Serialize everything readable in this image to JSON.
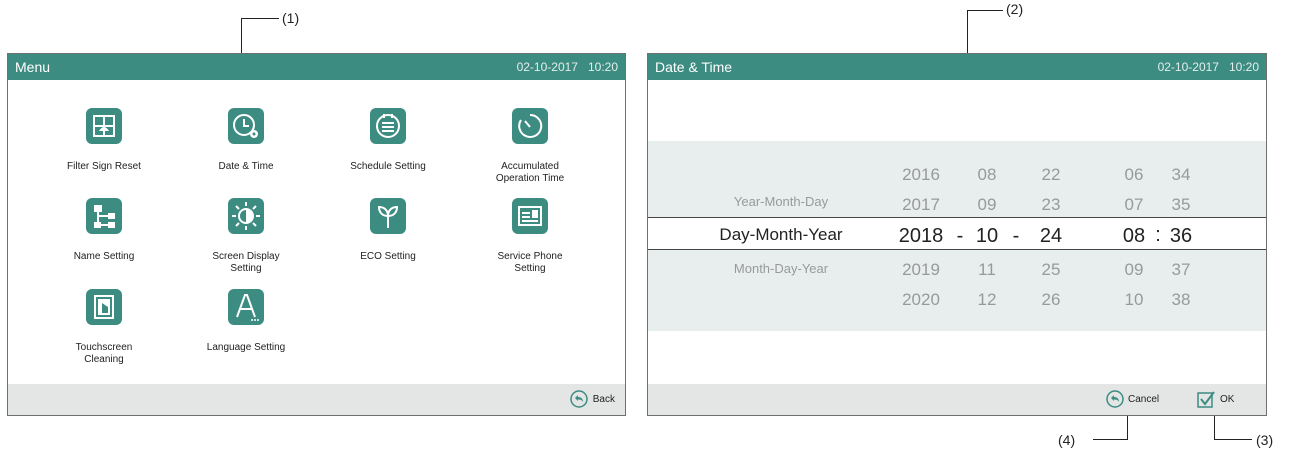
{
  "menu_screen": {
    "title": "Menu",
    "date": "02-10-2017",
    "time": "10:20",
    "items": [
      {
        "label": "Filter Sign Reset",
        "icon": "filter-icon"
      },
      {
        "label": "Date & Time",
        "icon": "clock-gear-icon"
      },
      {
        "label": "Schedule Setting",
        "icon": "calendar-icon"
      },
      {
        "label": "Accumulated\nOperation Time",
        "icon": "timer-icon"
      },
      {
        "label": "Name Setting",
        "icon": "hierarchy-icon"
      },
      {
        "label": "Screen Display\nSetting",
        "icon": "brightness-icon"
      },
      {
        "label": "ECO Setting",
        "icon": "sprout-icon"
      },
      {
        "label": "Service Phone\nSetting",
        "icon": "contact-card-icon"
      },
      {
        "label": "Touchscreen\nCleaning",
        "icon": "touch-screen-icon"
      },
      {
        "label": "Language Setting",
        "icon": "language-icon"
      }
    ],
    "back_label": "Back"
  },
  "datetime_screen": {
    "title": "Date & Time",
    "date": "02-10-2017",
    "time": "10:20",
    "formats": [
      "Year-Month-Day",
      "Day-Month-Year",
      "Month-Day-Year"
    ],
    "selected_format": "Day-Month-Year",
    "years": [
      "2016",
      "2017",
      "2018",
      "2019",
      "2020"
    ],
    "months": [
      "08",
      "09",
      "10",
      "11",
      "12"
    ],
    "days": [
      "22",
      "23",
      "24",
      "25",
      "26"
    ],
    "hours": [
      "06",
      "07",
      "08",
      "09",
      "10"
    ],
    "minutes": [
      "34",
      "35",
      "36",
      "37",
      "38"
    ],
    "date_separator": "-",
    "time_separator": ":",
    "cancel_label": "Cancel",
    "ok_label": "OK"
  },
  "callouts": {
    "c1": "(1)",
    "c2": "(2)",
    "c3": "(3)",
    "c4": "(4)"
  },
  "colors": {
    "accent": "#3d8c82",
    "picker_bg": "#e8eeee",
    "footer_bg": "#e4e6e6"
  }
}
